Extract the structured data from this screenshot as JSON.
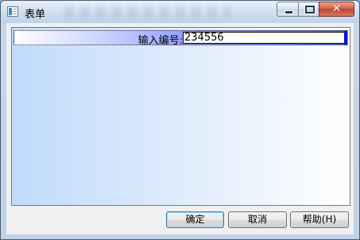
{
  "window": {
    "title": "表单"
  },
  "form": {
    "label": "输入编号:",
    "number_value": "234556"
  },
  "buttons": {
    "ok": "确定",
    "cancel": "取消",
    "help": "帮助(H)"
  },
  "caption": {
    "close_glyph": "✕"
  },
  "icons": [
    "app-icon",
    "minimize-icon",
    "maximize-icon",
    "close-icon"
  ]
}
